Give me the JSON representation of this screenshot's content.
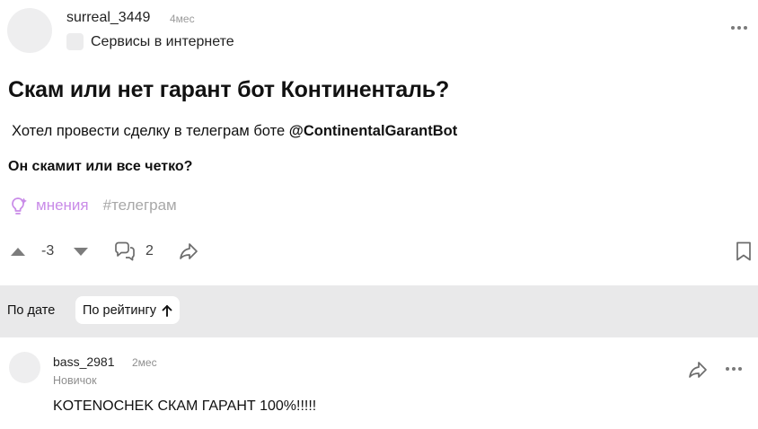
{
  "post": {
    "author": "surreal_3449",
    "time": "4мес",
    "community": "Сервисы в интернете",
    "title": "Скам или нет гарант бот Континенталь?",
    "body_prefix": "Хотел провести сделку в телеграм боте ",
    "body_mention": "@ContinentalGarantBot",
    "body_question": "Он скамит или все четко?",
    "tag_category": "мнения",
    "tag_hashtag": "#телеграм",
    "score": "-3",
    "comments_count": "2",
    "icons": [
      "more-horizontal-icon",
      "lightbulb-icon",
      "arrow-up-icon",
      "arrow-down-icon",
      "comments-icon",
      "share-icon",
      "bookmark-icon"
    ]
  },
  "sort": {
    "by_date": "По дате",
    "by_rating": "По рейтингу"
  },
  "comment": {
    "author": "bass_2981",
    "time": "2мес",
    "rank": "Новичок",
    "text": "KOTENOCHEK СКАМ ГАРАНТ 100%!!!!!"
  },
  "colors": {
    "tag_accent": "#c98be8",
    "sort_bar_bg": "#e9e9ea",
    "muted_text": "#9a9a9a"
  }
}
